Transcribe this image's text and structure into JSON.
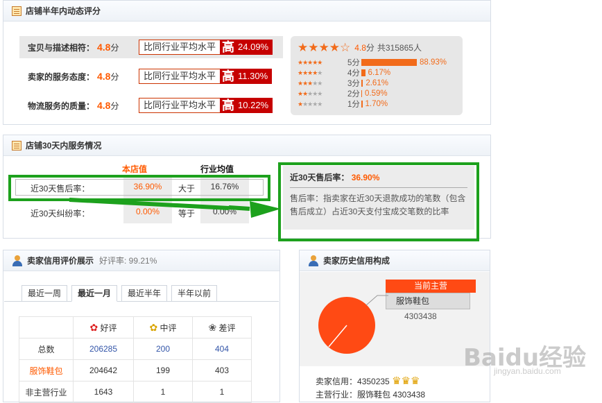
{
  "panel1": {
    "title": "店铺半年内动态评分",
    "rows": [
      {
        "label": "宝贝与描述相符：",
        "score": "4.8",
        "unit": "分",
        "compare": "比同行业平均水平",
        "level": "高",
        "pct": "24.09%"
      },
      {
        "label": "卖家的服务态度：",
        "score": "4.8",
        "unit": "分",
        "compare": "比同行业平均水平",
        "level": "高",
        "pct": "11.30%"
      },
      {
        "label": "物流服务的质量：",
        "score": "4.8",
        "unit": "分",
        "compare": "比同行业平均水平",
        "level": "高",
        "pct": "10.22%"
      }
    ],
    "summary": {
      "score": "4.8",
      "unit": "分",
      "total": "共315865人"
    },
    "distribution": [
      {
        "level": "5分",
        "pct": "88.93%",
        "value": 88.93,
        "stars": 5
      },
      {
        "level": "4分",
        "pct": "6.17%",
        "value": 6.17,
        "stars": 4
      },
      {
        "level": "3分",
        "pct": "2.61%",
        "value": 2.61,
        "stars": 3
      },
      {
        "level": "2分",
        "pct": "0.59%",
        "value": 0.59,
        "stars": 2
      },
      {
        "level": "1分",
        "pct": "1.70%",
        "value": 1.7,
        "stars": 1
      }
    ]
  },
  "panel2": {
    "title": "店铺30天内服务情况",
    "col_shop": "本店值",
    "col_industry": "行业均值",
    "rows": [
      {
        "label": "近30天售后率：",
        "shop": "36.90%",
        "cmp": "大于",
        "industry": "16.76%"
      },
      {
        "label": "近30天纠纷率：",
        "shop": "0.00%",
        "cmp": "等于",
        "industry": "0.00%"
      }
    ],
    "tip": {
      "title": "近30天售后率：",
      "value": "36.90%",
      "desc": "售后率：指卖家在近30天退款成功的笔数（包含售后成立）占近30天支付宝成交笔数的比率"
    }
  },
  "panel3": {
    "title": "卖家信用评价展示",
    "rate_label": "好评率: 99.21%",
    "tabs": [
      "最近一周",
      "最近一月",
      "最近半年",
      "半年以前"
    ],
    "active_tab": 1,
    "headers": [
      "好评",
      "中评",
      "差评"
    ],
    "rows": [
      {
        "label": "总数",
        "good": "206285",
        "mid": "200",
        "bad": "404"
      },
      {
        "label": "服饰鞋包",
        "good": "204642",
        "mid": "199",
        "bad": "403"
      },
      {
        "label": "非主营行业",
        "good": "1643",
        "mid": "1",
        "bad": "1"
      }
    ]
  },
  "panel4": {
    "title": "卖家历史信用构成",
    "main_label": "当前主营",
    "main_cat": "服饰鞋包",
    "main_val": "4303438",
    "credit_label": "卖家信用：",
    "credit_val": "4350235",
    "main_line": "主营行业：服饰鞋包 4303438"
  },
  "watermark": "Baidu经验",
  "watermark_url": "jingyan.baidu.com",
  "colors": {
    "accent": "#ff5a00",
    "high": "#c60000",
    "highlight": "#1da11d"
  }
}
